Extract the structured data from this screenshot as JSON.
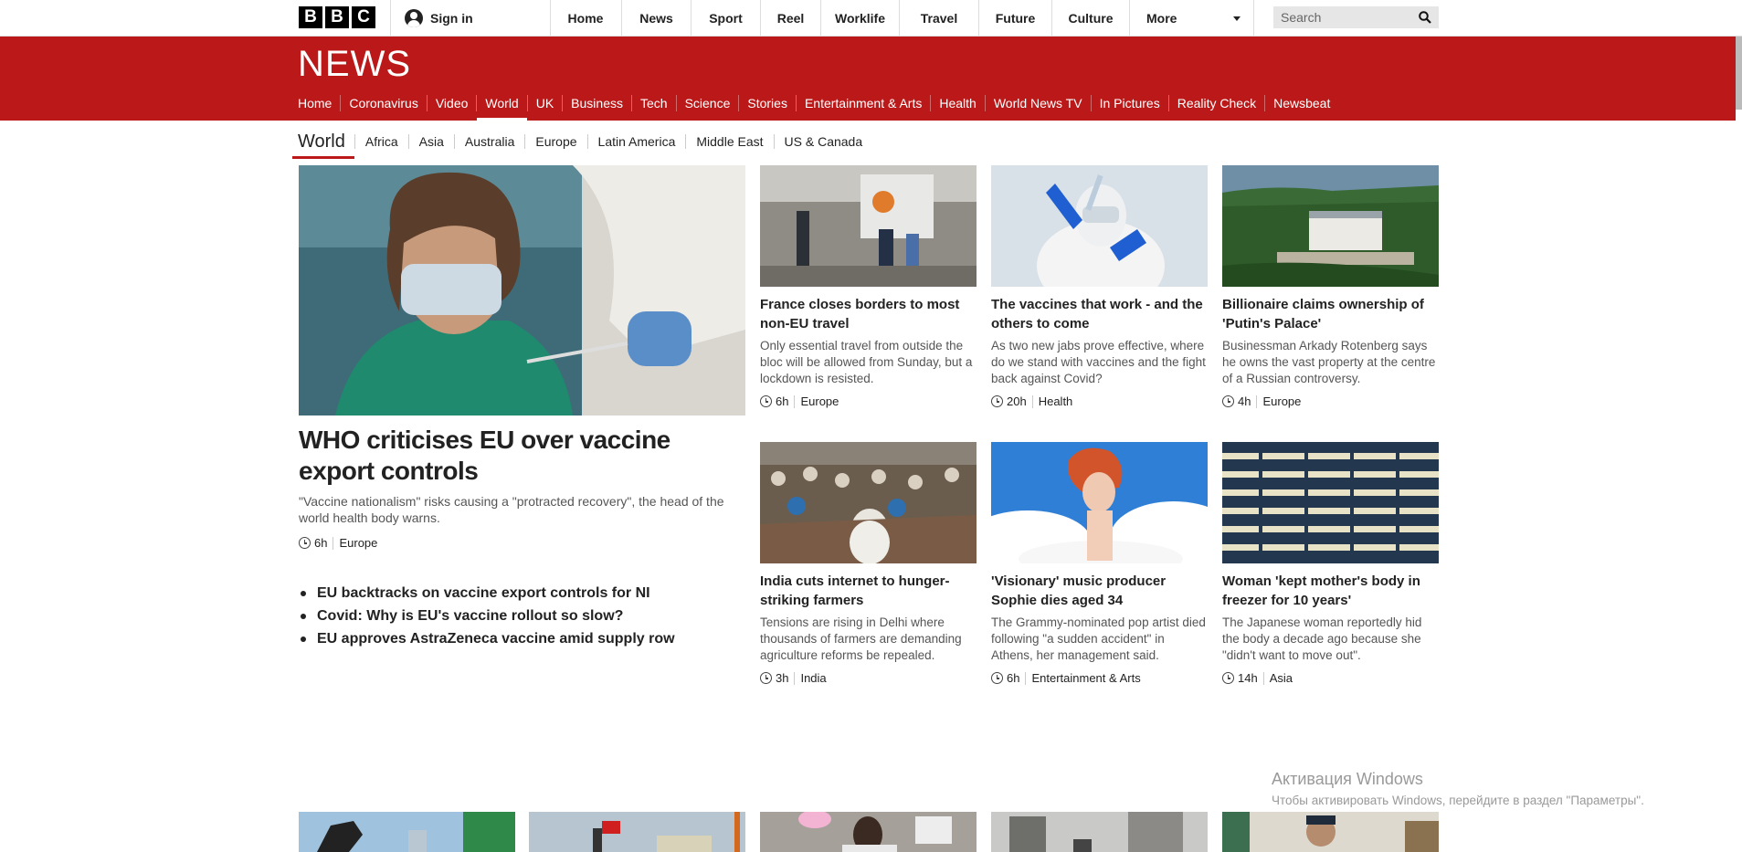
{
  "logo": {
    "letters": [
      "B",
      "B",
      "C"
    ]
  },
  "topbar": {
    "signin_label": "Sign in",
    "nav": [
      "Home",
      "News",
      "Sport",
      "Reel",
      "Worklife",
      "Travel",
      "Future",
      "Culture"
    ],
    "more_label": "More",
    "search_placeholder": "Search"
  },
  "newsband": {
    "logo": "NEWS",
    "nav": [
      "Home",
      "Coronavirus",
      "Video",
      "World",
      "UK",
      "Business",
      "Tech",
      "Science",
      "Stories",
      "Entertainment & Arts",
      "Health",
      "World News TV",
      "In Pictures",
      "Reality Check",
      "Newsbeat"
    ],
    "active": "World"
  },
  "subnav": {
    "main": "World",
    "items": [
      "Africa",
      "Asia",
      "Australia",
      "Europe",
      "Latin America",
      "Middle East",
      "US & Canada"
    ]
  },
  "lead": {
    "title": "WHO criticises EU over vaccine export controls",
    "summary": "\"Vaccine nationalism\" risks causing a \"protracted recovery\", the head of the world health body warns.",
    "time": "6h",
    "section": "Europe",
    "related": [
      "EU backtracks on vaccine export controls for NI",
      "Covid: Why is EU's vaccine rollout so slow?",
      "EU approves AstraZeneca vaccine amid supply row"
    ]
  },
  "cards": [
    {
      "title": "France closes borders to most non-EU travel",
      "summary": "Only essential travel from outside the bloc will be allowed from Sunday, but a lockdown is resisted.",
      "time": "6h",
      "section": "Europe"
    },
    {
      "title": "The vaccines that work - and the others to come",
      "summary": "As two new jabs prove effective, where do we stand with vaccines and the fight back against Covid?",
      "time": "20h",
      "section": "Health"
    },
    {
      "title": "Billionaire claims ownership of 'Putin's Palace'",
      "summary": "Businessman Arkady Rotenberg says he owns the vast property at the centre of a Russian controversy.",
      "time": "4h",
      "section": "Europe"
    },
    {
      "title": "India cuts internet to hunger-striking farmers",
      "summary": "Tensions are rising in Delhi where thousands of farmers are demanding agriculture reforms be repealed.",
      "time": "3h",
      "section": "India"
    },
    {
      "title": "'Visionary' music producer Sophie dies aged 34",
      "summary": "The Grammy-nominated pop artist died following \"a sudden accident\" in Athens, her management said.",
      "time": "6h",
      "section": "Entertainment & Arts"
    },
    {
      "title": "Woman 'kept mother's body in freezer for 10 years'",
      "summary": "The Japanese woman reportedly hid the body a decade ago because she \"didn't want to move out\".",
      "time": "14h",
      "section": "Asia"
    }
  ],
  "watermark": {
    "line1": "Активация Windows",
    "line2": "Чтобы активировать Windows, перейдите в раздел \"Параметры\"."
  },
  "colors": {
    "brand_red": "#bb1919",
    "text": "#222222",
    "muted": "#555555"
  }
}
